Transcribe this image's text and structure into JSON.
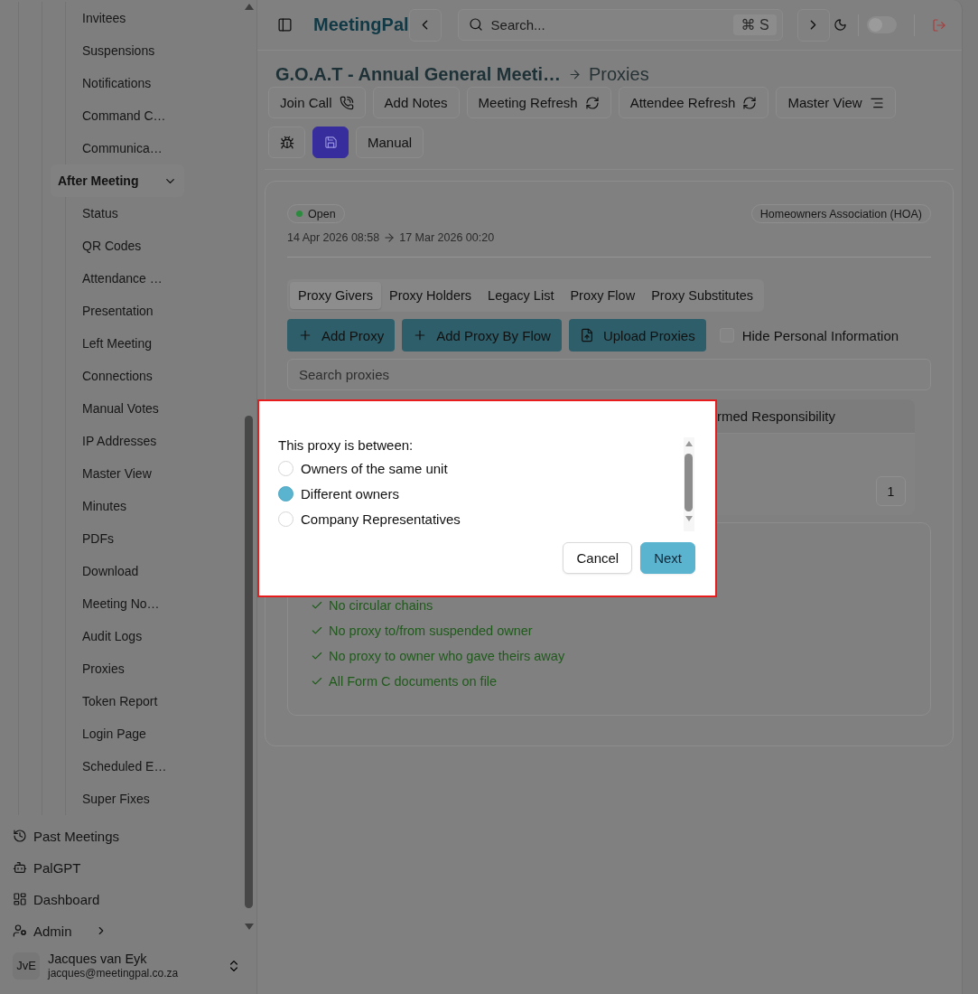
{
  "sidebar": {
    "meeting_nav": [
      {
        "children": [
          {
            "label": "Invitees"
          },
          {
            "label": "Suspensions"
          },
          {
            "label": "Notifications"
          },
          {
            "label": "Command C…"
          },
          {
            "label": "Communica…"
          }
        ]
      },
      {
        "label": "After Meeting",
        "expanded": true,
        "children": [
          {
            "label": "Status"
          },
          {
            "label": "QR Codes"
          },
          {
            "label": "Attendance …"
          },
          {
            "label": "Presentation"
          },
          {
            "label": "Left Meeting"
          },
          {
            "label": "Connections"
          },
          {
            "label": "Manual Votes"
          },
          {
            "label": "IP Addresses"
          },
          {
            "label": "Master View"
          },
          {
            "label": "Minutes"
          },
          {
            "label": "PDFs"
          },
          {
            "label": "Download"
          },
          {
            "label": "Meeting No…"
          },
          {
            "label": "Audit Logs"
          },
          {
            "label": "Proxies"
          },
          {
            "label": "Token Report"
          },
          {
            "label": "Login Page"
          },
          {
            "label": "Scheduled E…"
          },
          {
            "label": "Super Fixes"
          }
        ]
      }
    ],
    "main_nav": [
      {
        "label": "Past Meetings",
        "kind": "link"
      },
      {
        "label": "PalGPT",
        "kind": "link"
      },
      {
        "label": "Dashboard",
        "kind": "link"
      },
      {
        "label": "Admin",
        "kind": "group",
        "expanded": false
      }
    ],
    "user": {
      "initials": "JvE",
      "name": "Jacques van Eyk",
      "email": "jacques@meetingpal.co.za"
    }
  },
  "header": {
    "logo": "MeetingPal",
    "search": {
      "placeholder": "Search...",
      "shortcut": "⌘ S"
    },
    "dark_mode": false
  },
  "breadcrumb": {
    "meeting": "G.O.A.T - Annual General Meeti…",
    "page": "Proxies"
  },
  "toolbar": [
    [
      {
        "kind": "text",
        "label": "Join Call"
      },
      {
        "kind": "text",
        "label": "Add Notes"
      },
      {
        "kind": "text",
        "label": "Meeting Refresh"
      },
      {
        "kind": "text",
        "label": "Attendee Refresh"
      },
      {
        "kind": "text",
        "label": "Master View"
      }
    ],
    [
      {
        "kind": "icon"
      },
      {
        "kind": "accent"
      },
      {
        "kind": "text",
        "label": "Manual"
      }
    ]
  ],
  "meeting_card": {
    "status": "Open",
    "association": "Homeowners Association (HOA)",
    "start": "14 Apr 2026 08:58",
    "end": "17 Mar 2026 00:20",
    "tabs": [
      {
        "label": "Proxy Givers",
        "selected": true
      },
      {
        "label": "Proxy Holders",
        "selected": false
      },
      {
        "label": "Legacy List",
        "selected": false
      },
      {
        "label": "Proxy Flow",
        "selected": false
      },
      {
        "label": "Proxy Substitutes",
        "selected": false
      }
    ],
    "actions": [
      {
        "label": "Add Proxy"
      },
      {
        "label": "Add Proxy By Flow"
      },
      {
        "label": "Upload Proxies"
      }
    ],
    "hide_personal_information": {
      "label": "Hide Personal Information",
      "checked": false
    },
    "search": {
      "placeholder": "Search proxies"
    },
    "table": {
      "columns": [
        "rmed Responsibility"
      ],
      "pages": [
        {
          "label": "1",
          "selected": true
        }
      ]
    },
    "checks": [
      {
        "label": "No circular chains",
        "passed": true
      },
      {
        "label": "No proxy to/from suspended owner",
        "passed": true
      },
      {
        "label": "No proxy to owner who gave theirs away",
        "passed": true
      },
      {
        "label": "All Form C documents on file",
        "passed": true
      }
    ]
  },
  "dialog": {
    "prompt": "This proxy is between:",
    "options": [
      {
        "label": "Owners of the same unit",
        "selected": false
      },
      {
        "label": "Different owners",
        "selected": true
      },
      {
        "label": "Company Representatives",
        "selected": false
      }
    ],
    "buttons": [
      {
        "label": "Cancel",
        "kind": "secondary"
      },
      {
        "label": "Next",
        "kind": "primary"
      }
    ]
  }
}
